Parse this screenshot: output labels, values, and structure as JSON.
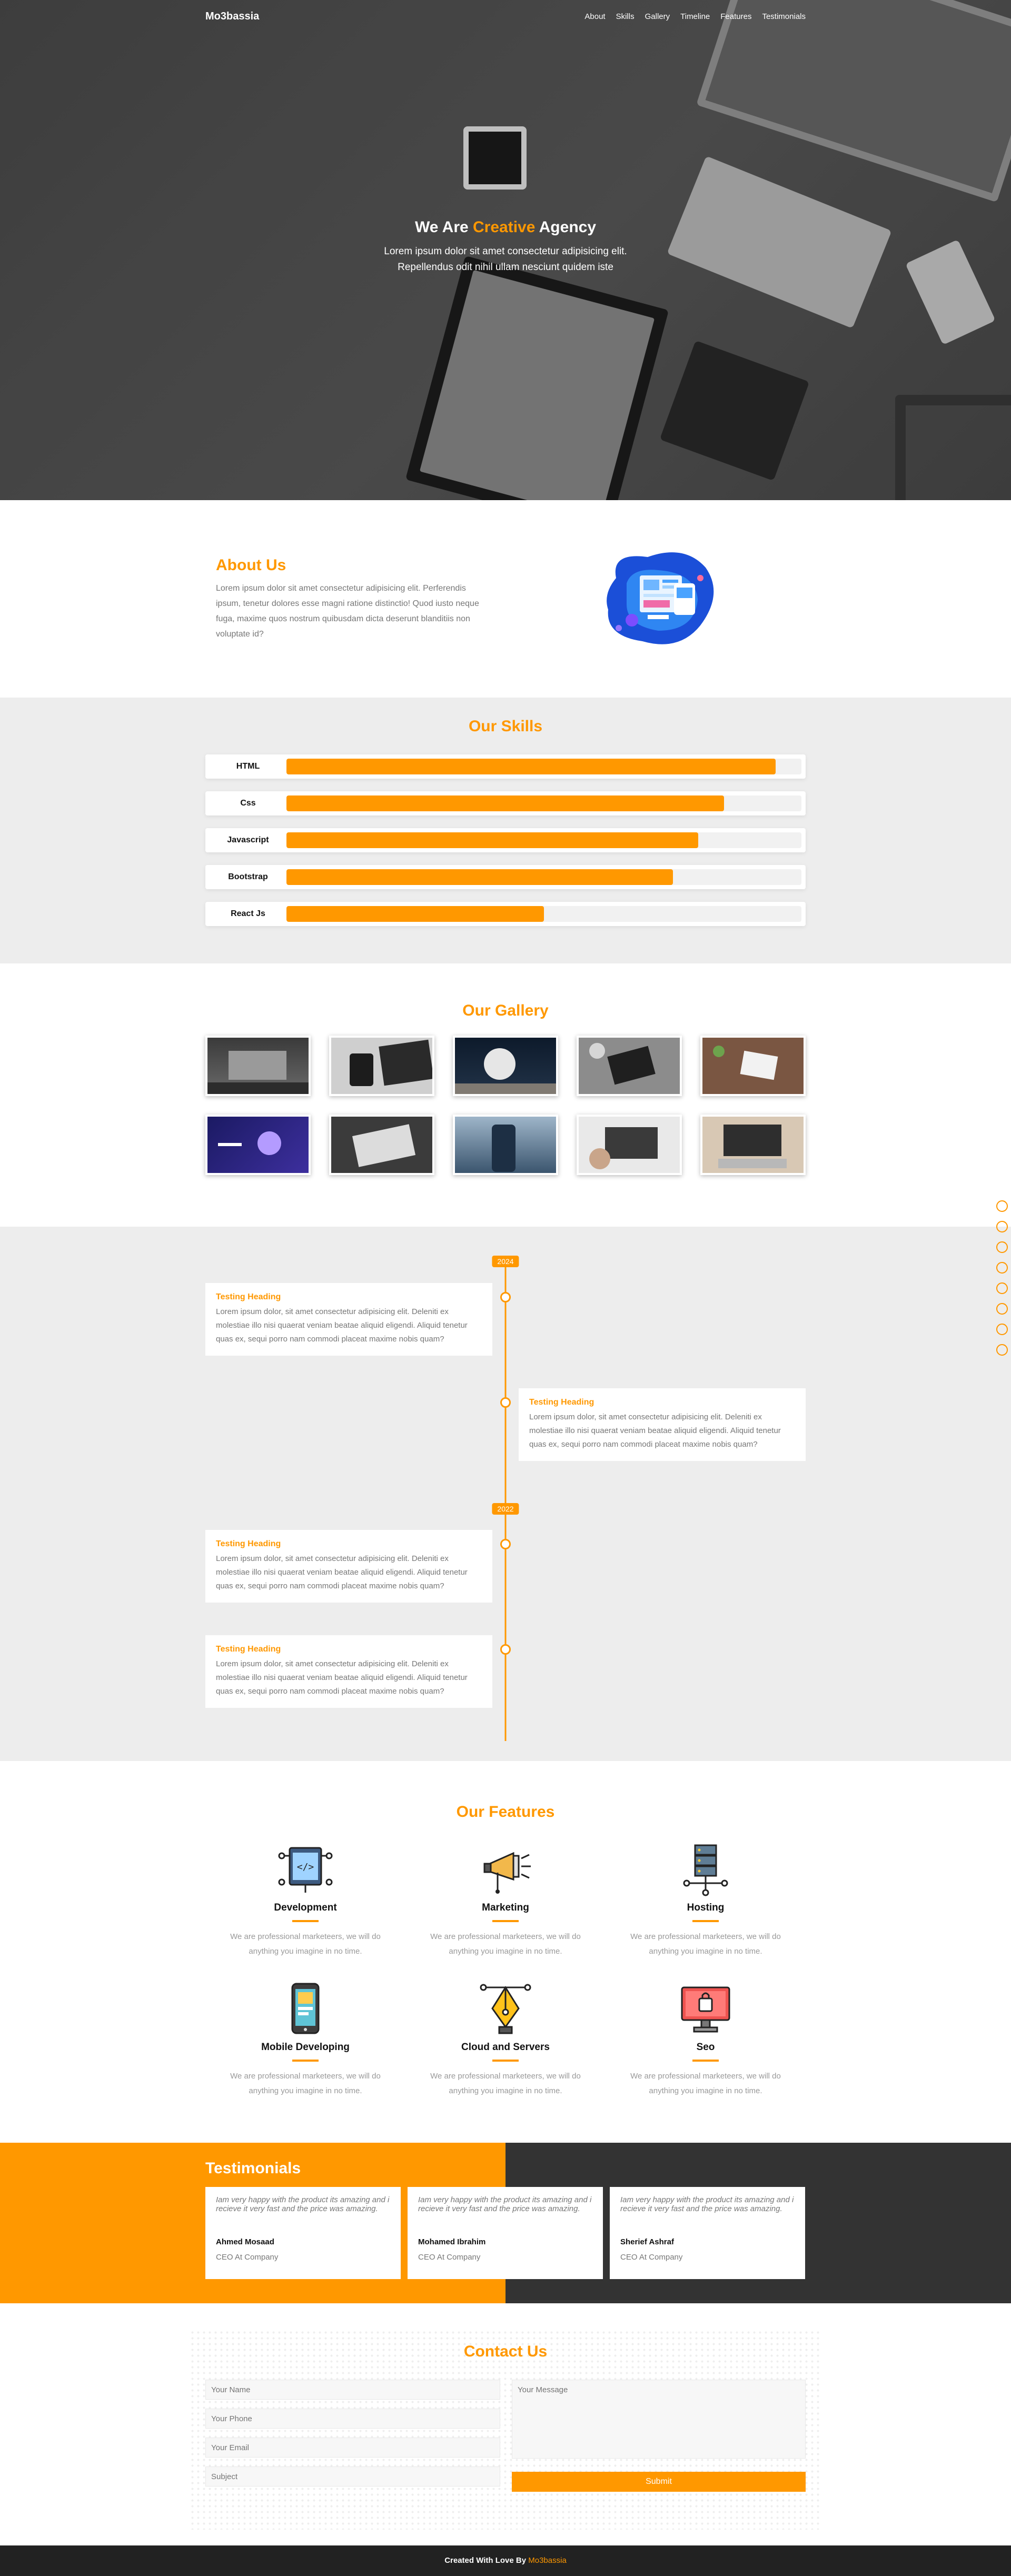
{
  "nav": {
    "logo": "Mo3bassia",
    "links": [
      "About",
      "Skills",
      "Gallery",
      "Timeline",
      "Features",
      "Testimonials"
    ]
  },
  "hero": {
    "title_pre": "We Are ",
    "title_accent": "Creative",
    "title_post": " Agency",
    "line1": "Lorem ipsum dolor sit amet consectetur adipisicing elit.",
    "line2": "Repellendus odit nihil ullam nesciunt quidem iste"
  },
  "about": {
    "title": "About Us",
    "text": "Lorem ipsum dolor sit amet consectetur adipisicing elit. Perferendis ipsum, tenetur dolores esse magni ratione distinctio! Quod iusto neque fuga, maxime quos nostrum quibusdam dicta deserunt blanditiis non voluptate id?"
  },
  "skills": {
    "title": "Our Skills",
    "items": [
      {
        "name": "HTML",
        "level": 0.95
      },
      {
        "name": "Css",
        "level": 0.85
      },
      {
        "name": "Javascript",
        "level": 0.8
      },
      {
        "name": "Bootstrap",
        "level": 0.75
      },
      {
        "name": "React Js",
        "level": 0.5
      }
    ]
  },
  "gallery": {
    "title": "Our Gallery"
  },
  "timeline": {
    "years": [
      "2024",
      "2022"
    ],
    "cards": [
      {
        "heading": "Testing Heading",
        "text": "Lorem ipsum dolor, sit amet consectetur adipisicing elit. Deleniti ex molestiae illo nisi quaerat veniam beatae aliquid eligendi. Aliquid tenetur quas ex, sequi porro nam commodi placeat maxime nobis quam?"
      },
      {
        "heading": "Testing Heading",
        "text": "Lorem ipsum dolor, sit amet consectetur adipisicing elit. Deleniti ex molestiae illo nisi quaerat veniam beatae aliquid eligendi. Aliquid tenetur quas ex, sequi porro nam commodi placeat maxime nobis quam?"
      },
      {
        "heading": "Testing Heading",
        "text": "Lorem ipsum dolor, sit amet consectetur adipisicing elit. Deleniti ex molestiae illo nisi quaerat veniam beatae aliquid eligendi. Aliquid tenetur quas ex, sequi porro nam commodi placeat maxime nobis quam?"
      },
      {
        "heading": "Testing Heading",
        "text": "Lorem ipsum dolor, sit amet consectetur adipisicing elit. Deleniti ex molestiae illo nisi quaerat veniam beatae aliquid eligendi. Aliquid tenetur quas ex, sequi porro nam commodi placeat maxime nobis quam?"
      }
    ]
  },
  "features": {
    "title": "Our Features",
    "items": [
      {
        "name": "Development",
        "text": "We are professional marketeers, we will do anything you imagine in no time.",
        "icon": "code-icon"
      },
      {
        "name": "Marketing",
        "text": "We are professional marketeers, we will do anything you imagine in no time.",
        "icon": "megaphone-icon"
      },
      {
        "name": "Hosting",
        "text": "We are professional marketeers, we will do anything you imagine in no time.",
        "icon": "server-icon"
      },
      {
        "name": "Mobile Developing",
        "text": "We are professional marketeers, we will do anything you imagine in no time.",
        "icon": "mobile-icon"
      },
      {
        "name": "Cloud and Servers",
        "text": "We are professional marketeers, we will do anything you imagine in no time.",
        "icon": "pen-tool-icon"
      },
      {
        "name": "Seo",
        "text": "We are professional marketeers, we will do anything you imagine in no time.",
        "icon": "monitor-icon"
      }
    ]
  },
  "testimonials": {
    "title": "Testimonials",
    "items": [
      {
        "quote": "Iam very happy with the product its amazing and i recieve it very fast and the price was amazing.",
        "name": "Ahmed Mosaad",
        "role": "CEO At Company"
      },
      {
        "quote": "Iam very happy with the product its amazing and i recieve it very fast and the price was amazing.",
        "name": "Mohamed Ibrahim",
        "role": "CEO At Company"
      },
      {
        "quote": "Iam very happy with the product its amazing and i recieve it very fast and the price was amazing.",
        "name": "Sherief Ashraf",
        "role": "CEO At Company"
      }
    ]
  },
  "contact": {
    "title": "Contact Us",
    "name_placeholder": "Your Name",
    "phone_placeholder": "Your Phone",
    "email_placeholder": "Your Email",
    "subject_placeholder": "Subject",
    "message_placeholder": "Your Message",
    "submit_label": "Submit"
  },
  "footer": {
    "text": "Created With Love By ",
    "brand": "Mo3bassia"
  },
  "colors": {
    "accent": "#ff9800",
    "dark": "#333333",
    "section_gray": "#ededed"
  }
}
